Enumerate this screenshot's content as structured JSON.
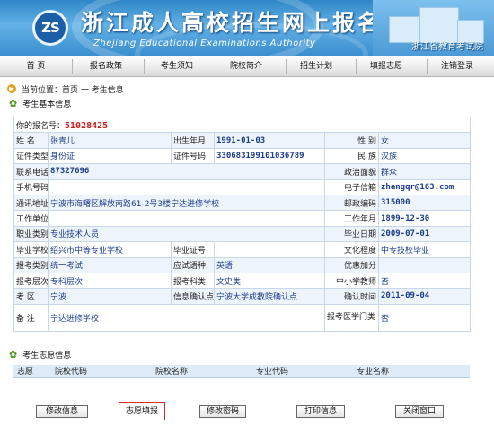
{
  "banner": {
    "logo_glyph": "ZS",
    "title": "浙江成人高校招生网上报名",
    "subtitle": "Zhejiang Educational Examinations Authority",
    "org": "浙江省教育考试院"
  },
  "nav": [
    "首 页",
    "报名政策",
    "考生须知",
    "院校简介",
    "招生计划",
    "填报志愿",
    "注销登录"
  ],
  "breadcrumb": "当前位置：首页 一 考生信息",
  "basic_section": "考生基本信息",
  "regno_label": "你的报名号：",
  "regno": "51028425",
  "fields": {
    "name_l": "姓 名",
    "name_v": "张青儿",
    "birth_l": "出生年月",
    "birth_v": "1991-01-03",
    "gender_l": "性 别",
    "gender_v": "女",
    "idtype_l": "证件类型",
    "idtype_v": "身份证",
    "idno_l": "证件号码",
    "idno_v": "330683199101036789",
    "nation_l": "民 族",
    "nation_v": "汉族",
    "phone_l": "联系电话",
    "phone_v": "87327696",
    "politics_l": "政治面貌",
    "politics_v": "群众",
    "mobile_l": "手机号码",
    "mobile_v": "",
    "email_l": "电子信箱",
    "email_v": "zhangqr@163.com",
    "addr_l": "通讯地址",
    "addr_v": "宁波市海曙区解放南路61-2号3楼宁达进修学校",
    "zip_l": "邮政编码",
    "zip_v": "315000",
    "work_l": "工作单位",
    "work_v": "",
    "workdate_l": "工作年月",
    "workdate_v": "1899-12-30",
    "job_l": "职业类别",
    "job_v": "专业技术人员",
    "grad_date_l": "毕业日期",
    "grad_date_v": "2009-07-01",
    "school_l": "毕业学校",
    "school_v": "绍兴市中等专业学校",
    "cert_l": "毕业证号",
    "cert_v": "",
    "edu_l": "文化程度",
    "edu_v": "中专技校毕业",
    "exam_type_l": "报考类别",
    "exam_type_v": "统一考试",
    "lang_l": "应试语种",
    "lang_v": "英语",
    "bonus_l": "优惠加分",
    "bonus_v": "",
    "level_l": "报考层次",
    "level_v": "专科层次",
    "subj_l": "报考科类",
    "subj_v": "文史类",
    "teacher_l": "中小学教师",
    "teacher_v": "否",
    "site_l": "考 区",
    "site_v": "宁波",
    "confirm_l": "信息确认点",
    "confirm_v": "宁波大学成教院确认点",
    "ctime_l": "确认时间",
    "ctime_v": "2011-09-04",
    "note_l": "备 注",
    "note_v": "宁达进修学校",
    "med_l": "报考医学门类",
    "med_v": "否"
  },
  "vol_section": "考生志愿信息",
  "vol_headers": [
    "志愿",
    "院校代码",
    "院校名称",
    "专业代码",
    "专业名称"
  ],
  "buttons": [
    "修改信息",
    "志愿填报",
    "修改密码",
    "打印信息",
    "关闭窗口"
  ],
  "colors": {
    "banner": "#3b8fcf",
    "value_text": "#1b3d8c",
    "regno": "#d21a1a",
    "border": "#c8d8ea"
  }
}
